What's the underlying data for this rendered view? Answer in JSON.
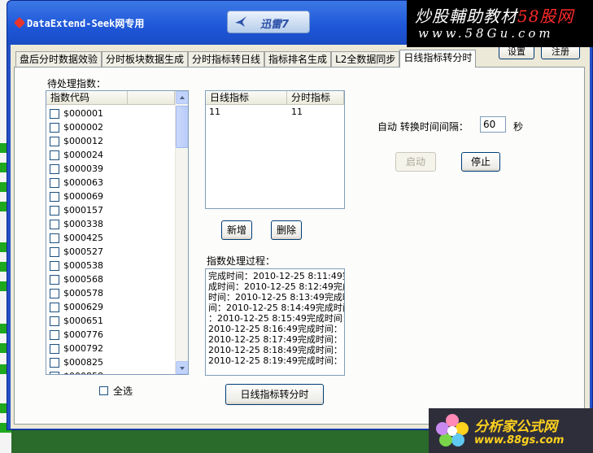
{
  "window": {
    "title": "DataExtend-Seek网专用"
  },
  "ad_top": {
    "text": "迅雷7"
  },
  "watermark_top": {
    "line1_a": "炒股輔助教材",
    "line1_b": "58股网",
    "line2": "www.58Gu.com"
  },
  "header_buttons": {
    "settings": "设置",
    "register": "注册"
  },
  "tabs": [
    {
      "label": "盘后分时数据效验"
    },
    {
      "label": "分时板块数据生成"
    },
    {
      "label": "分时指标转日线"
    },
    {
      "label": "指标排名生成"
    },
    {
      "label": "L2全数据同步"
    },
    {
      "label": "日线指标转分时",
      "active": true
    }
  ],
  "pending_index": {
    "label": "待处理指数：",
    "column": "指数代码",
    "items": [
      "$000001",
      "$000002",
      "$000012",
      "$000024",
      "$000039",
      "$000063",
      "$000069",
      "$000157",
      "$000338",
      "$000425",
      "$000527",
      "$000538",
      "$000568",
      "$000578",
      "$000629",
      "$000651",
      "$000776",
      "$000792",
      "$000825",
      "$000858"
    ]
  },
  "select_all": {
    "label": "全选"
  },
  "mapping_table": {
    "headers": [
      "日线指标",
      "分时指标"
    ],
    "rows": [
      [
        "11",
        "11"
      ]
    ]
  },
  "buttons": {
    "add": "新增",
    "delete": "删除",
    "start": "启动",
    "stop": "停止",
    "convert": "日线指标转分时"
  },
  "auto_interval": {
    "label": "自动 转换时间间隔：",
    "value": "60",
    "unit": "秒"
  },
  "process_log": {
    "label": "指数处理过程：",
    "lines": [
      "完成时间：2010-12-25 8:11:49完",
      "成时间：2010-12-25 8:12:49完成",
      "时间：2010-12-25 8:13:49完成时",
      "间：2010-12-25 8:14:49完成时间",
      "：2010-12-25 8:15:49完成时间：",
      "2010-12-25 8:16:49完成时间：",
      "2010-12-25 8:17:49完成时间：",
      "2010-12-25 8:18:49完成时间：",
      "2010-12-25 8:19:49完成时间："
    ]
  },
  "watermark_bottom": {
    "line1": "分析家公式网",
    "line2": "www.88gs.com"
  }
}
